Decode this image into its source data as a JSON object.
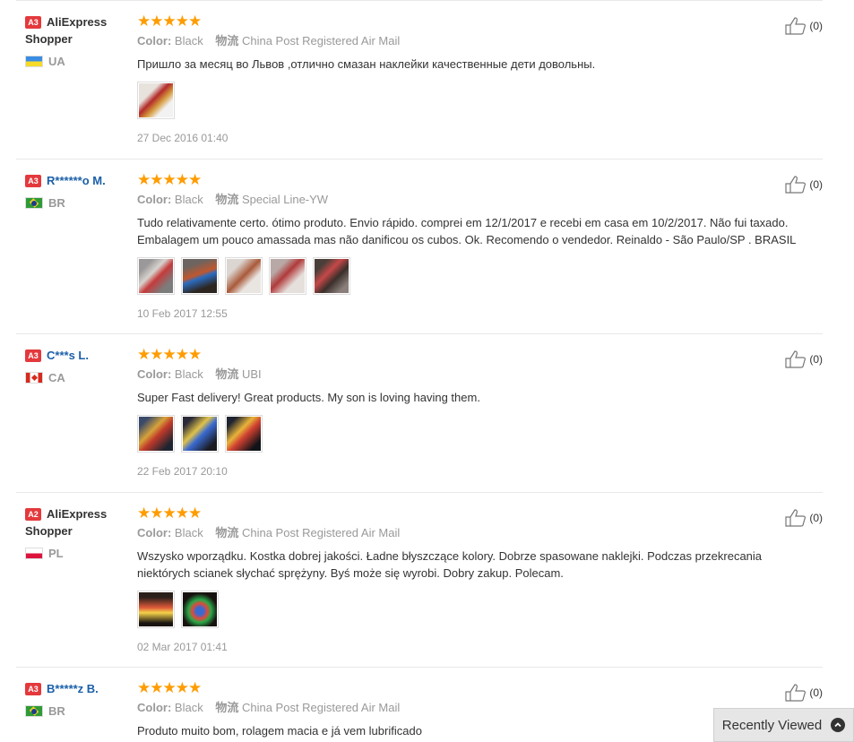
{
  "star_glyphs": "★★★★★",
  "color_key": "Color:",
  "shipping_key": "物流",
  "reviews": [
    {
      "level": "A3",
      "name": "AliExpress Shopper",
      "name_link": false,
      "country": "UA",
      "flag": "ua",
      "rating": 5,
      "color": "Black",
      "shipping": "China Post Registered Air Mail",
      "text": "Пришло за месяц во Львов ,отлично смазан наклейки качественные дети довольны.",
      "photos": [
        "photo-a"
      ],
      "date": "27 Dec 2016 01:40",
      "helpful": "(0)"
    },
    {
      "level": "A3",
      "name": "R******o M.",
      "name_link": true,
      "country": "BR",
      "flag": "br",
      "rating": 5,
      "color": "Black",
      "shipping": "Special Line-YW",
      "text": "Tudo relativamente certo. ótimo produto. Envio rápido. comprei em 12/1/2017 e recebi em casa em 10/2/2017. Não fui taxado. Embalagem um pouco amassada mas não danificou os cubos. Ok. Recomendo o vendedor. Reinaldo - São Paulo/SP . BRASIL",
      "photos": [
        "photo-b",
        "photo-c",
        "photo-d",
        "photo-e",
        "photo-f"
      ],
      "date": "10 Feb 2017 12:55",
      "helpful": "(0)"
    },
    {
      "level": "A3",
      "name": "C***s L.",
      "name_link": true,
      "country": "CA",
      "flag": "ca",
      "rating": 5,
      "color": "Black",
      "shipping": "UBI",
      "text": "Super Fast delivery! Great products. My son is loving having them.",
      "photos": [
        "photo-g",
        "photo-h",
        "photo-i"
      ],
      "date": "22 Feb 2017 20:10",
      "helpful": "(0)"
    },
    {
      "level": "A2",
      "name": "AliExpress Shopper",
      "name_link": false,
      "country": "PL",
      "flag": "pl",
      "rating": 5,
      "color": "Black",
      "shipping": "China Post Registered Air Mail",
      "text": "Wszysko wporządku. Kostka dobrej jakości. Ładne błyszczące kolory. Dobrze spasowane naklejki. Podczas przekrecania niektórych scianek słychać sprężyny. Byś może się wyrobi. Dobry zakup. Polecam.",
      "photos": [
        "photo-j",
        "photo-k"
      ],
      "date": "02 Mar 2017 01:41",
      "helpful": "(0)"
    },
    {
      "level": "A3",
      "name": "B*****z B.",
      "name_link": true,
      "country": "BR",
      "flag": "br",
      "rating": 5,
      "color": "Black",
      "shipping": "China Post Registered Air Mail",
      "text": "Produto muito bom, rolagem macia e já vem lubrificado",
      "photos": [],
      "date": "",
      "helpful": "(0)"
    }
  ],
  "recently_viewed": {
    "label": "Recently Viewed"
  },
  "colors": {
    "star": "#ff9c00",
    "level_badge": "#e4393c",
    "link": "#1a5fa8"
  }
}
